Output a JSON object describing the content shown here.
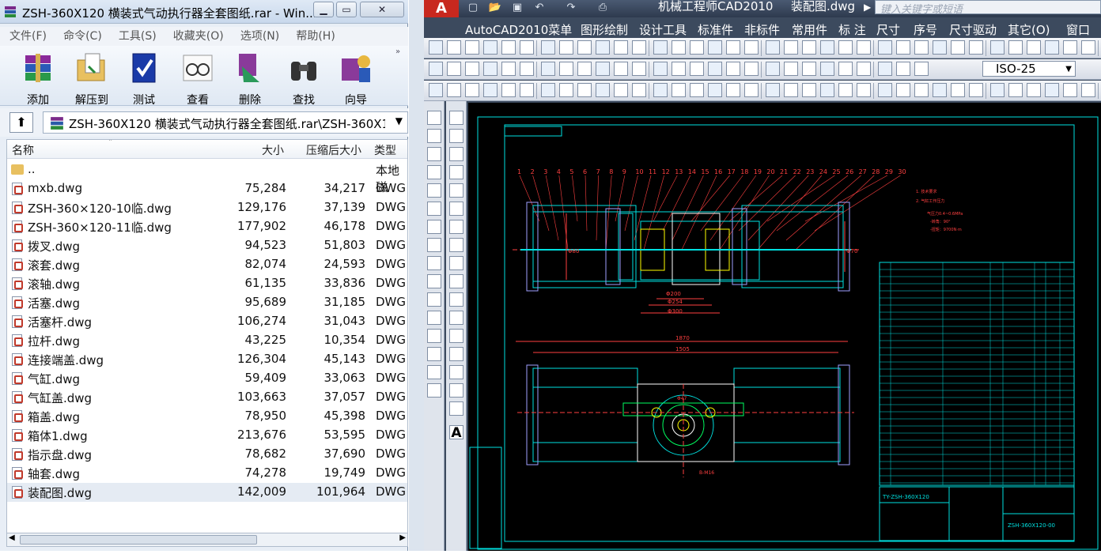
{
  "winrar": {
    "title": "ZSH-360X120 横装式气动执行器全套图纸.rar - Win...",
    "controls": {
      "minimize": "▭",
      "restore": "▭",
      "close": "✕"
    },
    "menu": [
      "文件(F)",
      "命令(C)",
      "工具(S)",
      "收藏夹(O)",
      "选项(N)",
      "帮助(H)"
    ],
    "toolbar": [
      "添加",
      "解压到",
      "测试",
      "查看",
      "删除",
      "查找",
      "向导"
    ],
    "path": "ZSH-360X120 横装式气动执行器全套图纸.rar\\ZSH-360X12",
    "columns": [
      "名称",
      "大小",
      "压缩后大小",
      "类型"
    ],
    "parent": {
      "name": "..",
      "type": "本地磁"
    },
    "files": [
      {
        "name": "mxb.dwg",
        "size": "75,284",
        "packed": "34,217",
        "type": "DWG"
      },
      {
        "name": "ZSH-360×120-10临.dwg",
        "size": "129,176",
        "packed": "37,139",
        "type": "DWG"
      },
      {
        "name": "ZSH-360×120-11临.dwg",
        "size": "177,902",
        "packed": "46,178",
        "type": "DWG"
      },
      {
        "name": "拨叉.dwg",
        "size": "94,523",
        "packed": "51,803",
        "type": "DWG"
      },
      {
        "name": "滚套.dwg",
        "size": "82,074",
        "packed": "24,593",
        "type": "DWG"
      },
      {
        "name": "滚轴.dwg",
        "size": "61,135",
        "packed": "33,836",
        "type": "DWG"
      },
      {
        "name": "活塞.dwg",
        "size": "95,689",
        "packed": "31,185",
        "type": "DWG"
      },
      {
        "name": "活塞杆.dwg",
        "size": "106,274",
        "packed": "31,043",
        "type": "DWG"
      },
      {
        "name": "拉杆.dwg",
        "size": "43,225",
        "packed": "10,354",
        "type": "DWG"
      },
      {
        "name": "连接端盖.dwg",
        "size": "126,304",
        "packed": "45,143",
        "type": "DWG"
      },
      {
        "name": "气缸.dwg",
        "size": "59,409",
        "packed": "33,063",
        "type": "DWG"
      },
      {
        "name": "气缸盖.dwg",
        "size": "103,663",
        "packed": "37,057",
        "type": "DWG"
      },
      {
        "name": "箱盖.dwg",
        "size": "78,950",
        "packed": "45,398",
        "type": "DWG"
      },
      {
        "name": "箱体1.dwg",
        "size": "213,676",
        "packed": "53,595",
        "type": "DWG"
      },
      {
        "name": "指示盘.dwg",
        "size": "78,682",
        "packed": "37,690",
        "type": "DWG"
      },
      {
        "name": "轴套.dwg",
        "size": "74,278",
        "packed": "19,749",
        "type": "DWG"
      },
      {
        "name": "装配图.dwg",
        "size": "142,009",
        "packed": "101,964",
        "type": "DWG"
      }
    ]
  },
  "acad": {
    "logo": "A",
    "title": "机械工程师CAD2010",
    "doc": "装配图.dwg",
    "search_placeholder": "键入关键字或短语",
    "menu": [
      "AutoCAD2010菜单",
      "图形绘制",
      "设计工具",
      "标准件",
      "非标件",
      "常用件",
      "标 注",
      "尺寸",
      "序号",
      "尺寸驱动",
      "其它(O)",
      "窗口"
    ],
    "dimstyle": "ISO-25",
    "left_text_tool": "A",
    "drawing": {
      "title_code": "TY-ZSH-360X120",
      "drawing_no": "ZSH-360X120-00",
      "dims": [
        "1870",
        "1505",
        "Φ200",
        "Φ254",
        "Φ300",
        "Φ70",
        "Φ80",
        "Φ47",
        "B-M16",
        "Φ20"
      ],
      "balloons": [
        "1",
        "2",
        "3",
        "4",
        "5",
        "6",
        "7",
        "8",
        "9",
        "10",
        "11",
        "12",
        "13",
        "14",
        "15",
        "16",
        "17",
        "18",
        "19",
        "20",
        "21",
        "22",
        "23",
        "24",
        "25",
        "26",
        "27",
        "28",
        "29",
        "30"
      ],
      "notes": [
        "1. 技术要求",
        "2. 气缸工作压力",
        "气压力0.4~0.6MPa",
        "-转角：90°",
        "-扭矩：9700N·m"
      ]
    }
  }
}
